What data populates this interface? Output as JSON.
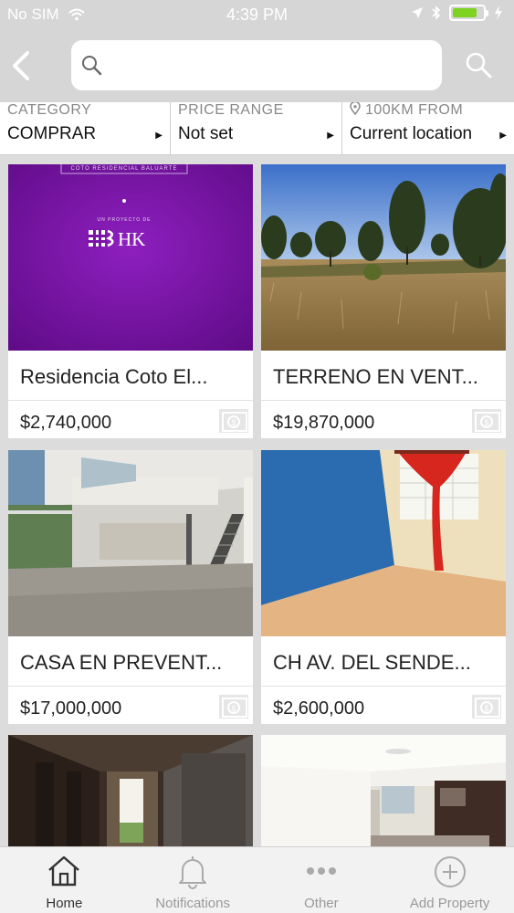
{
  "status_bar": {
    "carrier": "No SIM",
    "time": "4:39 PM"
  },
  "search": {
    "placeholder": ""
  },
  "filters": [
    {
      "label": "CATEGORY",
      "value": "COMPRAR"
    },
    {
      "label": "PRICE RANGE",
      "value": "Not set"
    },
    {
      "label": "100KM FROM",
      "value": "Current location"
    }
  ],
  "listings": [
    {
      "title": "Residencia Coto El...",
      "price": "$2,740,000",
      "image_text": {
        "top": "COTO RESIDENCIAL BALUARTE",
        "small": "UN PROYECTO DE",
        "logo": "HK"
      }
    },
    {
      "title": "TERRENO EN VENT...",
      "price": "$19,870,000"
    },
    {
      "title": "CASA EN PREVENT...",
      "price": "$17,000,000"
    },
    {
      "title": "CH AV. DEL SENDE...",
      "price": "$2,600,000"
    },
    {
      "title": "",
      "price": ""
    },
    {
      "title": "",
      "price": ""
    }
  ],
  "tabs": [
    {
      "label": "Home",
      "icon": "home-icon"
    },
    {
      "label": "Notifications",
      "icon": "bell-icon"
    },
    {
      "label": "Other",
      "icon": "more-icon"
    },
    {
      "label": "Add Property",
      "icon": "add-circle-icon"
    }
  ],
  "colors": {
    "battery": "#7ed321",
    "promo_purple": "#7d14a8",
    "header": "#d6d6d6"
  }
}
